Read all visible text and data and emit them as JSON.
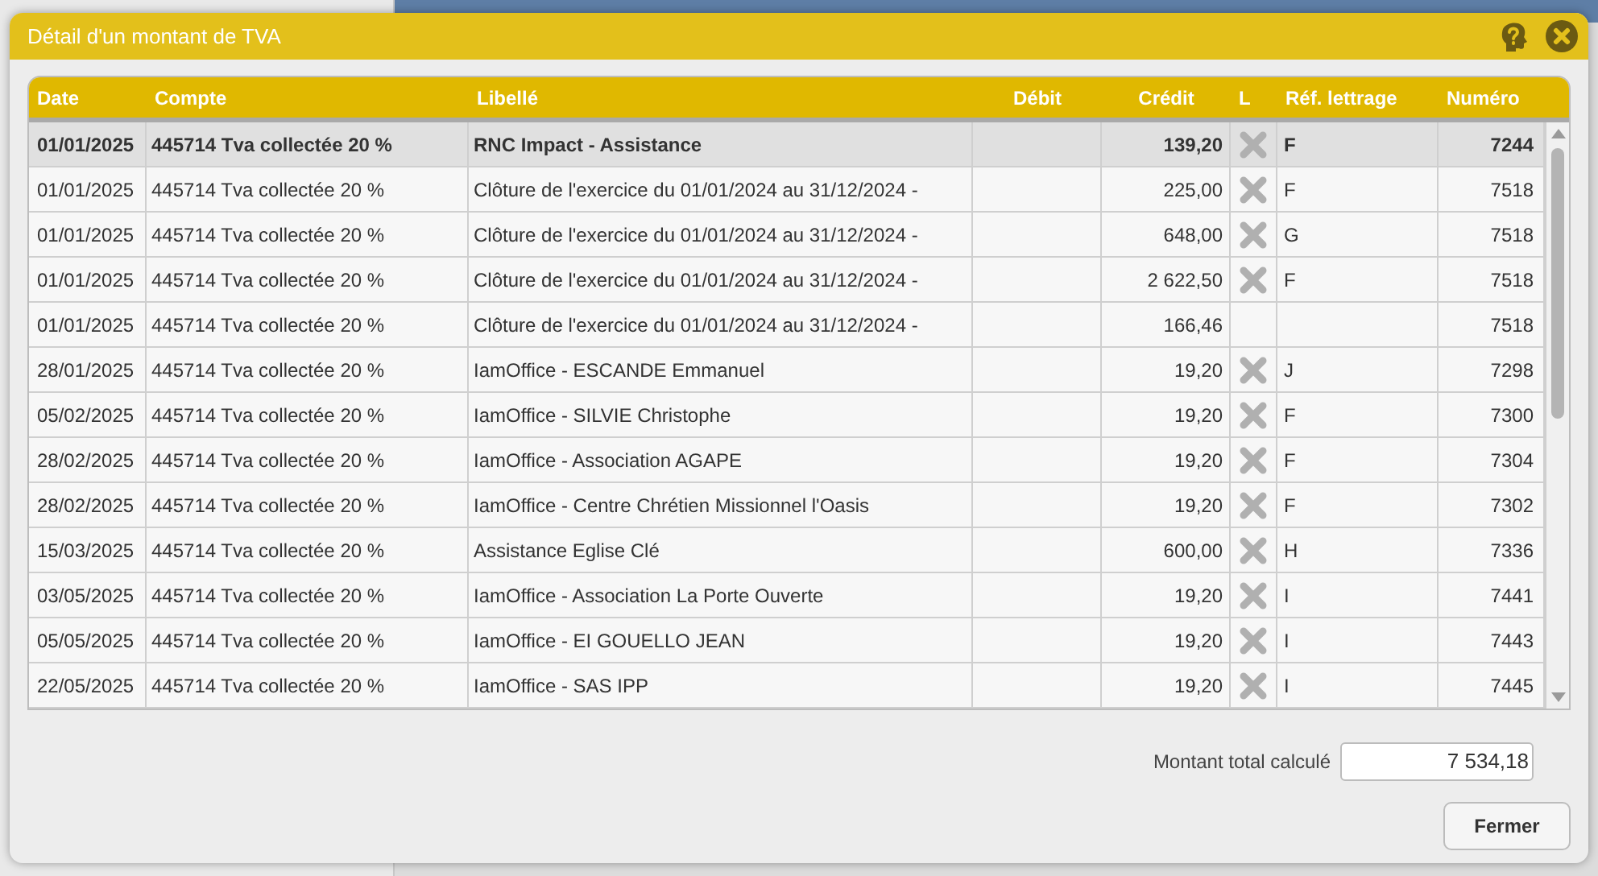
{
  "dialog": {
    "title": "Détail d'un montant de TVA"
  },
  "table": {
    "columns": [
      "Date",
      "Compte",
      "Libellé",
      "Débit",
      "Crédit",
      "L",
      "Réf. lettrage",
      "Numéro"
    ],
    "rows": [
      {
        "selected": true,
        "date": "01/01/2025",
        "compte": "445714 Tva collectée 20 %",
        "libelle": "RNC Impact - Assistance",
        "credit": "139,20",
        "lettered": true,
        "ref": "F",
        "numero": "7244"
      },
      {
        "selected": false,
        "date": "01/01/2025",
        "compte": "445714 Tva collectée 20 %",
        "libelle": "Clôture de l'exercice du 01/01/2024 au 31/12/2024 -",
        "credit": "225,00",
        "lettered": true,
        "ref": "F",
        "numero": "7518"
      },
      {
        "selected": false,
        "date": "01/01/2025",
        "compte": "445714 Tva collectée 20 %",
        "libelle": "Clôture de l'exercice du 01/01/2024 au 31/12/2024 -",
        "credit": "648,00",
        "lettered": true,
        "ref": "G",
        "numero": "7518"
      },
      {
        "selected": false,
        "date": "01/01/2025",
        "compte": "445714 Tva collectée 20 %",
        "libelle": "Clôture de l'exercice du 01/01/2024 au 31/12/2024 -",
        "credit": "2 622,50",
        "lettered": true,
        "ref": "F",
        "numero": "7518"
      },
      {
        "selected": false,
        "date": "01/01/2025",
        "compte": "445714 Tva collectée 20 %",
        "libelle": "Clôture de l'exercice du 01/01/2024 au 31/12/2024 -",
        "credit": "166,46",
        "lettered": false,
        "numero": "7518"
      },
      {
        "selected": false,
        "date": "28/01/2025",
        "compte": "445714 Tva collectée 20 %",
        "libelle": "IamOffice - ESCANDE Emmanuel",
        "credit": "19,20",
        "lettered": true,
        "ref": "J",
        "numero": "7298"
      },
      {
        "selected": false,
        "date": "05/02/2025",
        "compte": "445714 Tva collectée 20 %",
        "libelle": "IamOffice - SILVIE Christophe",
        "credit": "19,20",
        "lettered": true,
        "ref": "F",
        "numero": "7300"
      },
      {
        "selected": false,
        "date": "28/02/2025",
        "compte": "445714 Tva collectée 20 %",
        "libelle": "IamOffice - Association AGAPE",
        "credit": "19,20",
        "lettered": true,
        "ref": "F",
        "numero": "7304"
      },
      {
        "selected": false,
        "date": "28/02/2025",
        "compte": "445714 Tva collectée 20 %",
        "libelle": "IamOffice - Centre Chrétien Missionnel l'Oasis",
        "credit": "19,20",
        "lettered": true,
        "ref": "F",
        "numero": "7302"
      },
      {
        "selected": false,
        "date": "15/03/2025",
        "compte": "445714 Tva collectée 20 %",
        "libelle": "Assistance Eglise Clé",
        "credit": "600,00",
        "lettered": true,
        "ref": "H",
        "numero": "7336"
      },
      {
        "selected": false,
        "date": "03/05/2025",
        "compte": "445714 Tva collectée 20 %",
        "libelle": "IamOffice - Association La Porte Ouverte",
        "credit": "19,20",
        "lettered": true,
        "ref": "I",
        "numero": "7441"
      },
      {
        "selected": false,
        "date": "05/05/2025",
        "compte": "445714 Tva collectée 20 %",
        "libelle": "IamOffice - EI GOUELLO JEAN",
        "credit": "19,20",
        "lettered": true,
        "ref": "I",
        "numero": "7443"
      },
      {
        "selected": false,
        "date": "22/05/2025",
        "compte": "445714 Tva collectée 20 %",
        "libelle": "IamOffice - SAS IPP",
        "credit": "19,20",
        "lettered": true,
        "ref": "I",
        "numero": "7445"
      }
    ]
  },
  "total": {
    "label": "Montant total calculé",
    "value": "7 534,18"
  },
  "buttons": [
    "Fermer"
  ]
}
